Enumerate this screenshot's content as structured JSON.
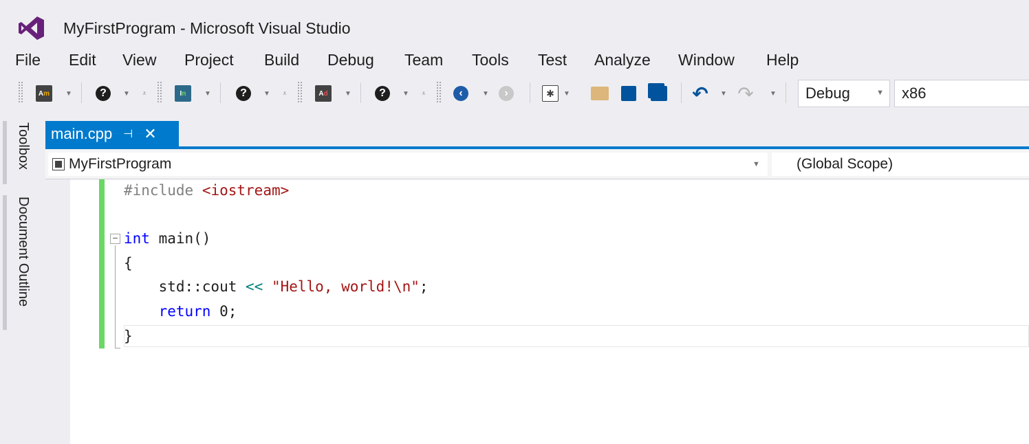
{
  "window": {
    "title": "MyFirstProgram - Microsoft Visual Studio"
  },
  "menu": [
    "File",
    "Edit",
    "View",
    "Project",
    "Build",
    "Debug",
    "Team",
    "Tools",
    "Test",
    "Analyze",
    "Window",
    "Help"
  ],
  "toolbar": {
    "config": "Debug",
    "platform": "x86",
    "icons": [
      "am-icon",
      "help-icon",
      "in-icon",
      "help-icon",
      "ad-icon",
      "help-icon",
      "back-icon",
      "forward-icon",
      "new-project-icon",
      "open-icon",
      "save-icon",
      "save-all-icon",
      "undo-icon",
      "redo-icon"
    ]
  },
  "sidebar": {
    "toolbox": "Toolbox",
    "outline": "Document Outline"
  },
  "tab": {
    "name": "main.cpp",
    "pin": "⊣",
    "close": "✕"
  },
  "nav": {
    "project": "MyFirstProgram",
    "scope": "(Global Scope)"
  },
  "code": {
    "include_kw": "#include",
    "include_file": "<iostream>",
    "int_kw": "int",
    "main_sig": " main()",
    "open_brace": "{",
    "cout": "    std::cout ",
    "shift_op": "<<",
    "string": "\"Hello, world!\\n\"",
    "semi": ";",
    "return_kw": "    return",
    "return_val": " 0;",
    "close_brace": "}"
  },
  "colors": {
    "accent": "#007acc",
    "changebar": "#6bd765",
    "keyword": "#0000ff",
    "string": "#a31515"
  }
}
